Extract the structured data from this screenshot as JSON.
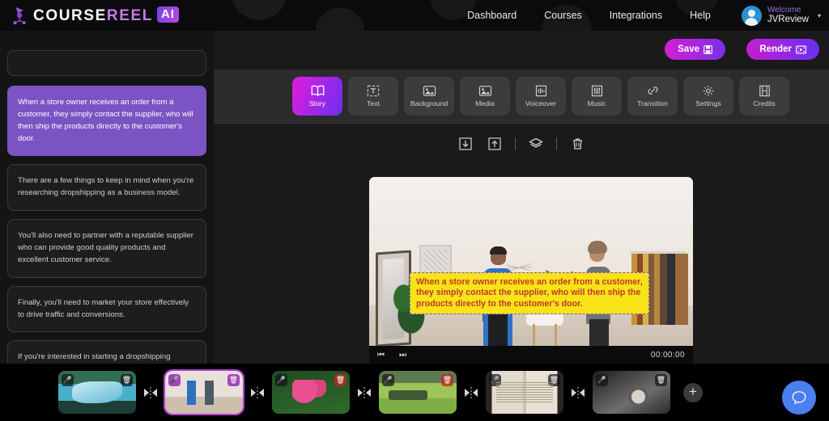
{
  "topbar": {
    "logo": {
      "part1": "COURSE",
      "part2": "REEL",
      "badge": "AI",
      "icon": "logo-icon"
    },
    "nav": [
      {
        "label": "Dashboard",
        "name": "nav-dashboard"
      },
      {
        "label": "Courses",
        "name": "nav-courses"
      },
      {
        "label": "Integrations",
        "name": "nav-integrations"
      },
      {
        "label": "Help",
        "name": "nav-help"
      }
    ],
    "user": {
      "welcome": "Welcome",
      "username": "JVReview",
      "caret": "▾"
    }
  },
  "actions": {
    "save_label": "Save",
    "save_icon": "save-disk-icon",
    "render_label": "Render",
    "render_icon": "film-icon",
    "save_color": "#d41fd4",
    "render_color": "#6a2ff0"
  },
  "toolbar": {
    "active": "Story",
    "tabs": [
      {
        "label": "Story",
        "icon": "book-icon"
      },
      {
        "label": "Text",
        "icon": "text-box-icon"
      },
      {
        "label": "Background",
        "icon": "image-icon"
      },
      {
        "label": "Media",
        "icon": "media-image-icon"
      },
      {
        "label": "Voiceover",
        "icon": "waveform-icon"
      },
      {
        "label": "Music",
        "icon": "mixer-icon"
      },
      {
        "label": "Transition",
        "icon": "link-icon"
      },
      {
        "label": "Settings",
        "icon": "gear-icon"
      },
      {
        "label": "Credits",
        "icon": "film-strip-icon"
      }
    ]
  },
  "script_panel": {
    "title_value": "",
    "title_placeholder": "",
    "active_index": 0,
    "items": [
      {
        "text": "When a store owner receives an order from a customer, they simply contact the supplier, who will then ship the products directly to the customer's door.",
        "selected": true
      },
      {
        "text": "There are a few things to keep in mind when you're researching dropshipping as a business model.",
        "selected": false
      },
      {
        "text": "You'll also need to partner with a reputable supplier who can provide good quality products and excellent customer service.",
        "selected": false
      },
      {
        "text": "Finally, you'll need to market your store effectively to drive traffic and conversions.",
        "selected": false
      },
      {
        "text": "If you're interested in starting a dropshipping business, the first step is to do your research.",
        "selected": false
      }
    ]
  },
  "preview": {
    "tools": [
      {
        "name": "download-icon",
        "glyph": "⬇"
      },
      {
        "name": "upload-icon",
        "glyph": "⬆"
      },
      {
        "name": "layers-icon",
        "glyph": "⬟"
      },
      {
        "name": "trash-icon",
        "glyph": "🗑"
      }
    ],
    "caption_text": "When a store owner receives an order from a customer, they simply contact the supplier, who will then ship the products directly to the customer's door.",
    "caption_bg": "#f7e317",
    "caption_color": "#c0392b",
    "caption_border": "#7a4fd6",
    "player": {
      "prev": "⏮",
      "next": "⏭",
      "time": "00:00:00"
    }
  },
  "timeline": {
    "add_label": "+",
    "clips": [
      {
        "name": "clip-waterfall",
        "mic": "mic-icon",
        "trash": "trash-icon",
        "selected": false,
        "trash_red": false
      },
      {
        "name": "clip-room-scene",
        "mic": "mic-icon",
        "trash": "trash-icon",
        "selected": true,
        "trash_red": false
      },
      {
        "name": "clip-pink-roses",
        "mic": "mic-icon",
        "trash": "trash-icon",
        "selected": false,
        "trash_red": true
      },
      {
        "name": "clip-green-field",
        "mic": "mic-icon",
        "trash": "trash-icon",
        "selected": false,
        "trash_red": true
      },
      {
        "name": "clip-open-book",
        "mic": "mic-icon",
        "trash": "trash-icon",
        "selected": false,
        "trash_red": false
      },
      {
        "name": "clip-car-key",
        "mic": "mic-icon",
        "trash": "trash-icon",
        "selected": false,
        "trash_red": false
      }
    ],
    "connector_icon": "transition-connector-icon"
  },
  "support": {
    "chat_icon": "chat-bubble-icon"
  }
}
